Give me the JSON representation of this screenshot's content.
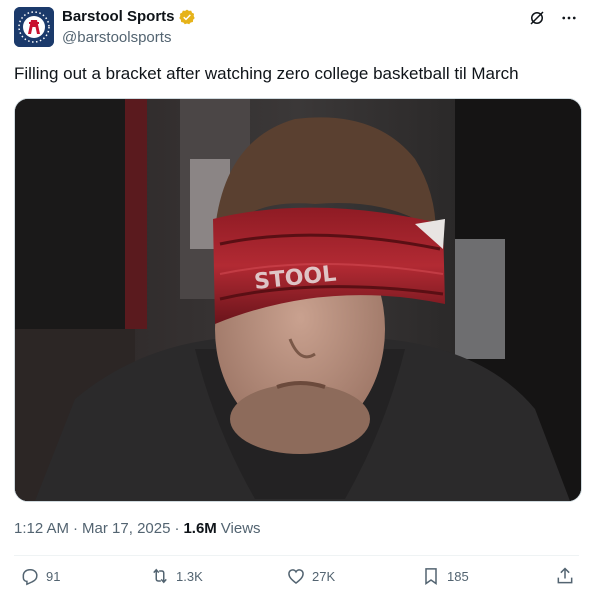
{
  "header": {
    "name": "Barstool Sports",
    "handle": "@barstoolsports",
    "avatar_icon": "barstool-logo-icon",
    "verified_icon": "verified-badge-icon",
    "colors": {
      "verified": "#f4c11e",
      "avatar_bg": "#1b3a6b"
    }
  },
  "top_icons": [
    "grok-icon",
    "more-icon"
  ],
  "tweet": {
    "text": "Filling out a bracket after watching zero college basketball til March"
  },
  "media": {
    "type": "image",
    "subject": "man-with-blindfold-photo"
  },
  "meta": {
    "time": "1:12 AM",
    "separator": "·",
    "date": "Mar 17, 2025",
    "views_count": "1.6M",
    "views_label": "Views"
  },
  "actions": {
    "replies": {
      "icon": "reply-icon",
      "count": "91"
    },
    "reposts": {
      "icon": "repost-icon",
      "count": "1.3K"
    },
    "likes": {
      "icon": "like-icon",
      "count": "27K"
    },
    "bookmarks": {
      "icon": "bookmark-icon",
      "count": "185"
    },
    "share": {
      "icon": "share-icon"
    }
  }
}
